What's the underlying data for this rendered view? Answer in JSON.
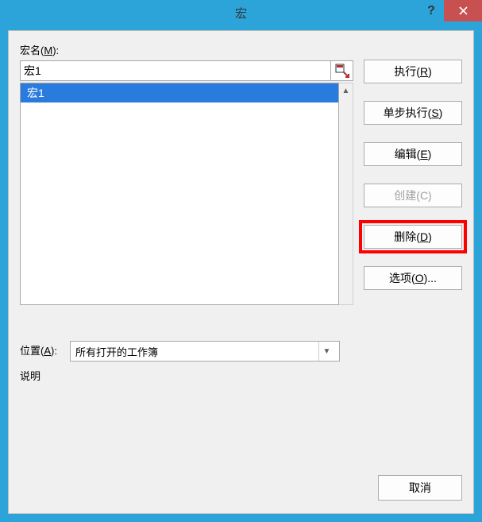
{
  "titlebar": {
    "title": "宏",
    "help_tooltip": "?",
    "close_tooltip": "×"
  },
  "labels": {
    "macro_name": "宏名(",
    "macro_name_key": "M",
    "macro_name_suffix": "):",
    "location": "位置(",
    "location_key": "A",
    "location_suffix": "):",
    "description": "说明"
  },
  "inputs": {
    "macro_name_value": "宏1",
    "location_value": "所有打开的工作簿"
  },
  "macro_list": {
    "items": [
      "宏1"
    ],
    "selected_index": 0
  },
  "buttons": {
    "run": "执行(",
    "run_key": "R",
    "step": "单步执行(",
    "step_key": "S",
    "edit": "编辑(",
    "edit_key": "E",
    "create": "创建(C)",
    "delete": "删除(",
    "delete_key": "D",
    "options": "选项(",
    "options_key": "O",
    "options_suffix": ")...",
    "cancel": "取消",
    "close_paren": ")"
  }
}
